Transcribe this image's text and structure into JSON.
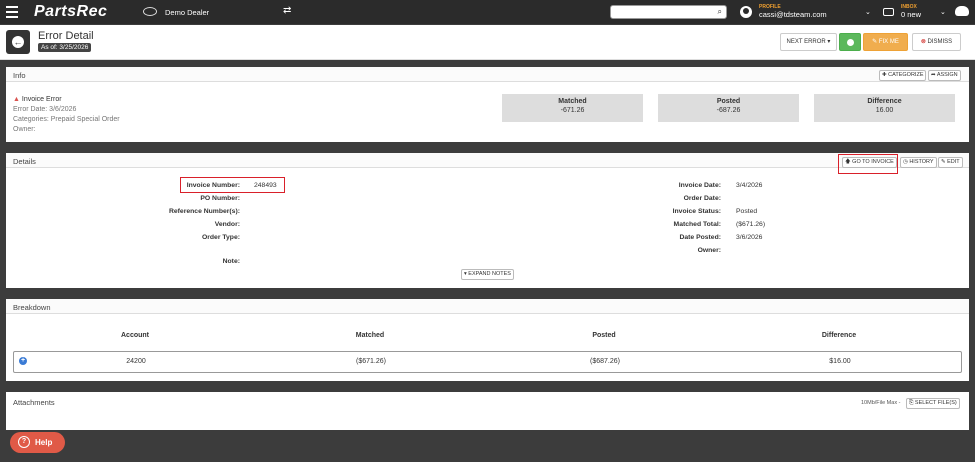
{
  "topbar": {
    "app_name": "PartsRec",
    "dealer": "Demo Dealer",
    "profile_label": "PROFILE",
    "profile_email": "cassi@tdsteam.com",
    "inbox_label": "INBOX",
    "inbox_count": "0 new"
  },
  "header": {
    "title": "Error Detail",
    "as_of": "As of: 3/25/2026",
    "next_error": "NEXT ERROR ▾",
    "fix_me": "✎ FIX ME",
    "dismiss": "DISMISS"
  },
  "info": {
    "title": "Info",
    "categorize": "✚ CATEGORIZE",
    "assign": "➦ ASSIGN",
    "error_type": "Invoice Error",
    "error_date": "Error Date: 3/6/2026",
    "categories": "Categories: Prepaid Special Order",
    "owner": "Owner:",
    "stats": [
      {
        "label": "Matched",
        "value": "-671.26"
      },
      {
        "label": "Posted",
        "value": "-687.26"
      },
      {
        "label": "Difference",
        "value": "16.00"
      }
    ]
  },
  "details": {
    "title": "Details",
    "go_to_invoice": "🡅 GO TO INVOICE",
    "history": "◷ HISTORY",
    "edit": "✎ EDIT",
    "left": [
      {
        "label": "Invoice Number:",
        "value": "248493"
      },
      {
        "label": "PO Number:",
        "value": ""
      },
      {
        "label": "Reference Number(s):",
        "value": ""
      },
      {
        "label": "Vendor:",
        "value": ""
      },
      {
        "label": "Order Type:",
        "value": ""
      },
      {
        "label": "Note:",
        "value": ""
      }
    ],
    "right": [
      {
        "label": "Invoice Date:",
        "value": "3/4/2026"
      },
      {
        "label": "Order Date:",
        "value": ""
      },
      {
        "label": "Invoice Status:",
        "value": "Posted"
      },
      {
        "label": "Matched Total:",
        "value": "($671.26)"
      },
      {
        "label": "Date Posted:",
        "value": "3/6/2026"
      },
      {
        "label": "Owner:",
        "value": ""
      }
    ],
    "expand_notes": "▾ EXPAND NOTES"
  },
  "breakdown": {
    "title": "Breakdown",
    "columns": [
      "Account",
      "Matched",
      "Posted",
      "Difference"
    ],
    "rows": [
      {
        "account": "24200",
        "matched": "($671.26)",
        "posted": "($687.26)",
        "difference": "$16.00"
      }
    ]
  },
  "attachments": {
    "title": "Attachments",
    "max_label": "10Mb/File Max -",
    "select_files": "⎘ SELECT FILE(S)"
  },
  "help": {
    "label": "Help"
  }
}
